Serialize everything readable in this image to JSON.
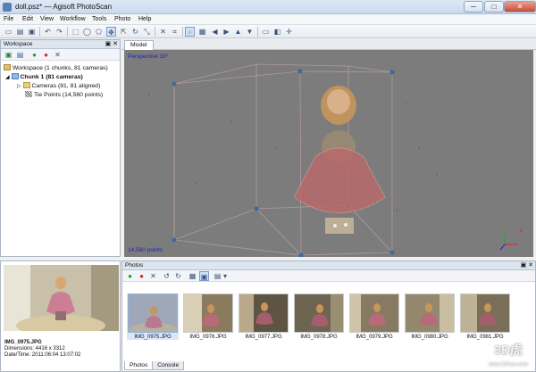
{
  "window": {
    "title": "doll.psz* — Agisoft PhotoScan",
    "minimize": "─",
    "maximize": "□",
    "close": "✕"
  },
  "menu": [
    "File",
    "Edit",
    "View",
    "Workflow",
    "Tools",
    "Photo",
    "Help"
  ],
  "workspace": {
    "header": "Workspace",
    "header_buttons": "▣ ✕",
    "root": "Workspace (1 chunks, 81 cameras)",
    "chunk": "Chunk 1 (81 cameras)",
    "cameras": "Cameras (81, 81 aligned)",
    "tie_points": "Tie Points (14,560 points)"
  },
  "model": {
    "tab": "Model",
    "perspective": "Perspective 30°",
    "points": "14,560 points",
    "axis_x": "X",
    "axis_y": "Y"
  },
  "thumbnail": {
    "filename": "IMG_0975.JPG",
    "dimensions": "Dimensions: 4416 x 3312",
    "datetime": "Date/Time: 2011:06:04 13:07:02"
  },
  "photos": {
    "header": "Photos",
    "header_buttons": "▣ ✕",
    "items": [
      "IMG_0975.JPG",
      "IMG_0976.JPG",
      "IMG_0977.JPG",
      "IMG_0978.JPG",
      "IMG_0979.JPG",
      "IMG_0980.JPG",
      "IMG_0981.JPG"
    ],
    "tabs": [
      "Photos",
      "Console"
    ]
  },
  "watermark": {
    "brand": "3D虎",
    "url": "www.3dhoo.com"
  },
  "colors": {
    "viewport_bg": "#7c7c7c",
    "label_blue": "#1c1cc8",
    "selection": "#d9e7f8"
  },
  "icons": {
    "toolbar": [
      "new-icon",
      "open-icon",
      "save-icon",
      "undo-icon",
      "redo-icon",
      "rect-select-icon",
      "circle-select-icon",
      "free-select-icon",
      "navigation-icon",
      "move-icon",
      "rotate-icon",
      "resize-icon",
      "delete-icon",
      "crop-icon",
      "points-icon",
      "view-icons",
      "camera-icon",
      "axis-icon"
    ]
  }
}
